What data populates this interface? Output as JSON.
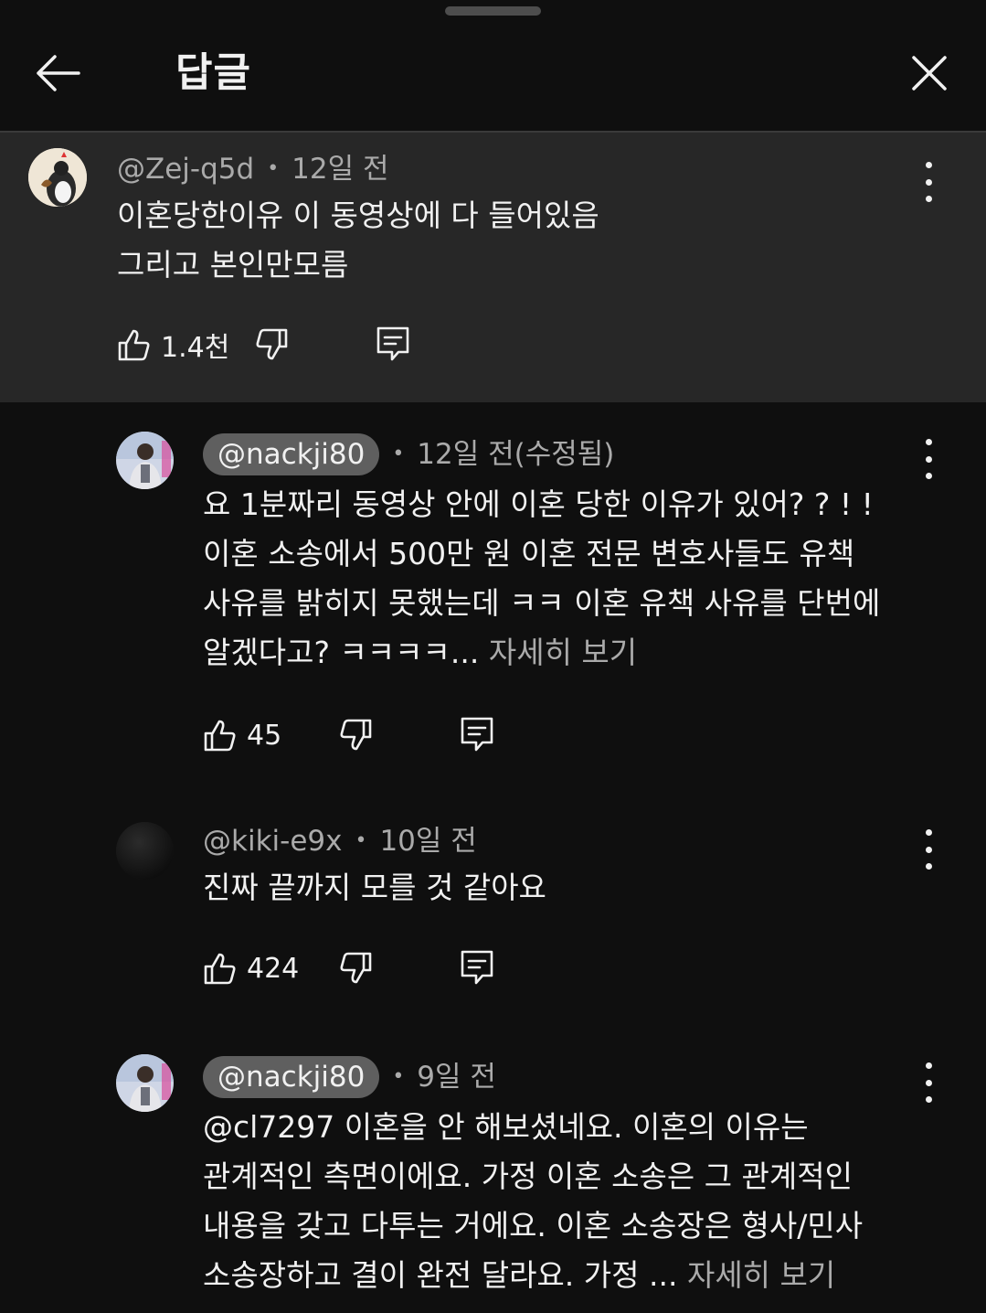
{
  "header": {
    "title": "답글",
    "back_icon": "arrow-left-icon",
    "close_icon": "close-icon"
  },
  "parent_comment": {
    "handle": "@Zej-q5d",
    "time": "12일 전",
    "lines": [
      "이혼당한이유 이 동영상에 다 들어있음",
      "그리고 본인만모름"
    ],
    "likes": "1.4천"
  },
  "replies": [
    {
      "handle": "@nackji80",
      "creator": true,
      "time": "12일 전(수정됨)",
      "lines": [
        "요 1분짜리  동영상 안에 이혼 당한 이유가 있어? ? ! !",
        "이혼 소송에서 500만 원 이혼 전문 변호사들도 유책",
        "사유를 밝히지 못했는데 ㅋㅋ 이혼 유책 사유를 단번에",
        "알겠다고?  ㅋㅋㅋㅋ..."
      ],
      "more_label": "자세히 보기",
      "likes": "45"
    },
    {
      "handle": "@kiki-e9x",
      "creator": false,
      "time": "10일 전",
      "lines": [
        "진짜 끝까지 모를 것 같아요"
      ],
      "likes": "424"
    },
    {
      "handle": "@nackji80",
      "creator": true,
      "time": "9일 전",
      "lines": [
        "@cl7297  이혼을 안 해보셨네요. 이혼의 이유는",
        "관계적인 측면이에요. 가정 이혼 소송은 그 관계적인",
        "내용을 갖고 다투는 거에요. 이혼 소송장은 형사/민사",
        "소송장하고 결이 완전 달라요.  가정 ..."
      ],
      "more_label": "자세히 보기"
    }
  ],
  "colors": {
    "background": "#0f0f0f",
    "parent_highlight": "#272727",
    "pill": "#5f5f5f",
    "secondary_text": "#aaaaaa"
  }
}
